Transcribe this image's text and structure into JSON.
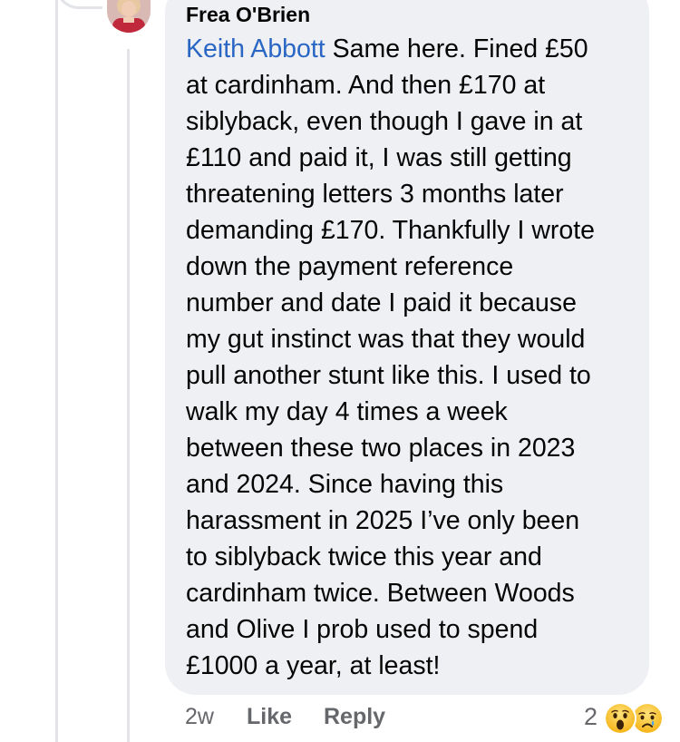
{
  "comment": {
    "author": "Frea O'Brien",
    "mention": "Keith Abbott",
    "lines": [
      " Same here. Fined £50",
      "at cardinham. And then £170 at",
      "siblyback, even though I gave in at",
      "£110 and paid it, I was still getting",
      "threatening letters 3 months later",
      "demanding £170. Thankfully I wrote",
      "down the payment reference",
      "number and date I paid it because",
      "my gut instinct was that they would",
      "pull another stunt like this. I used to",
      "walk my day 4 times a week",
      "between these two places in 2023",
      "and 2024. Since having this",
      "harassment in 2025 I’ve only been",
      "to siblyback twice this year and",
      "cardinham twice. Between Woods",
      "and Olive I prob used to spend",
      "£1000 a year, at least!"
    ]
  },
  "actions": {
    "time": "2w",
    "like_label": "Like",
    "reply_label": "Reply"
  },
  "reactions": {
    "count": "2",
    "icons": [
      "wow-emoji-icon",
      "sad-emoji-icon"
    ]
  },
  "colors": {
    "mention": "#2a66c4",
    "bubble": "#eef0f3",
    "meta": "#65676b",
    "thread_line": "#e2e4e8"
  }
}
